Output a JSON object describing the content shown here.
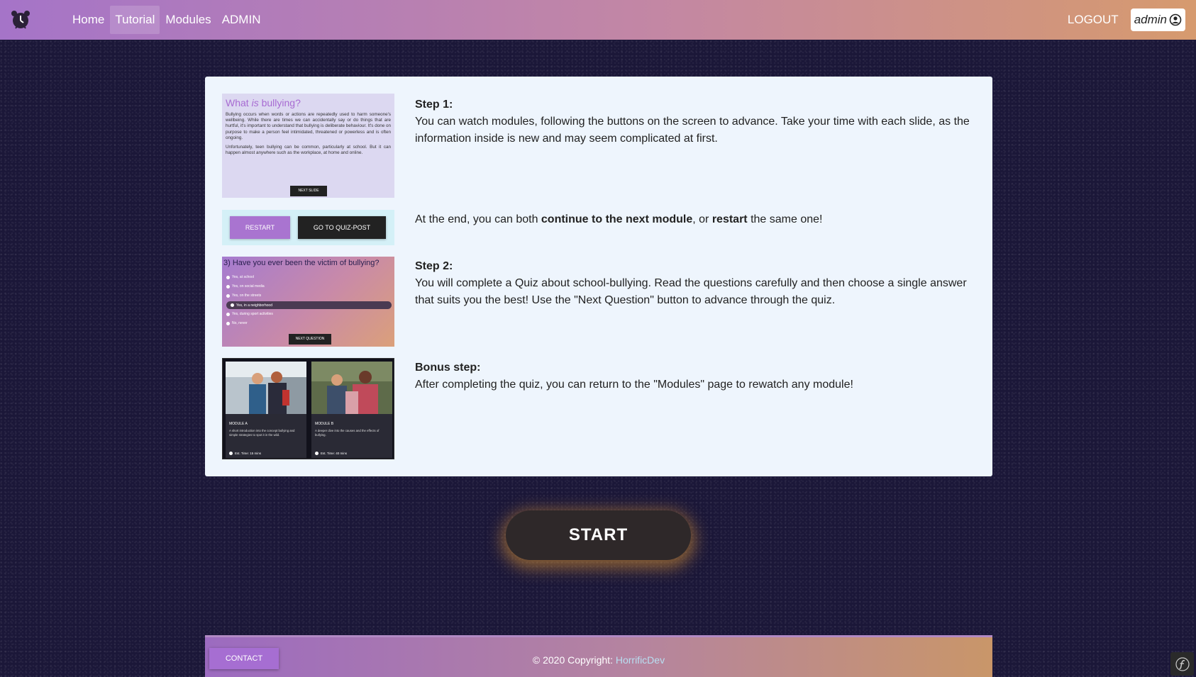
{
  "nav": {
    "items": [
      {
        "label": "Home",
        "active": false
      },
      {
        "label": "Tutorial",
        "active": true
      },
      {
        "label": "Modules",
        "active": false
      },
      {
        "label": "ADMIN",
        "active": false
      }
    ],
    "logout_label": "LOGOUT",
    "user_label": "admin",
    "logo_icon": "alarm-clock-icon",
    "user_icon": "user-circle-icon"
  },
  "thumbnails": {
    "t1": {
      "title_prefix": "What ",
      "title_italic": "is",
      "title_suffix": " bullying?",
      "p1": "Bullying occurs when words or actions are repeatedly used to harm someone's wellbeing. While there are times we can accidentally say or do things that are hurtful, it's important to understand that bullying is deliberate behaviour. It's done on purpose to make a person feel intimidated, threatened or powerless and is often ongoing.",
      "p2": "Unfortunately, teen bullying can be common, particularly at school. But it can happen almost anywhere such as the workplace, at home and online.",
      "button": "NEXT SLIDE"
    },
    "t2": {
      "restart": "RESTART",
      "quiz": "GO TO QUIZ-POST"
    },
    "t3": {
      "question": "3) Have you ever been the victim of bullying?",
      "options": [
        "Yes, at school",
        "Yes, on social media",
        "Yes, on the streets",
        "Yes, in a neighborhood",
        "Yes, during sport activities",
        "No, never"
      ],
      "button": "NEXT QUESTION"
    },
    "t4": {
      "module_a": {
        "title": "MODULE A",
        "desc": "A short introduction into the concept bullying and simple strategies to spot it in the wild.",
        "time": "Est. Time: 15 mins"
      },
      "module_b": {
        "title": "MODULE B",
        "desc": "A deeper dive into the causes and the effects of bullying.",
        "time": "Est. Time: 40 mins"
      }
    }
  },
  "steps": {
    "step1": {
      "heading": "Step 1:",
      "text": "You can watch modules, following the buttons on the screen to advance. Take your time with each slide, as the information inside is new and may seem complicated at first."
    },
    "end": {
      "pre": "At the end, you can both ",
      "b1": "continue to the next module",
      "mid": ", or ",
      "b2": "restart",
      "post": " the same one!"
    },
    "step2": {
      "heading": "Step 2:",
      "text": "You will complete a Quiz about school-bullying. Read the questions carefully and then choose a single answer that suits you the best! Use the \"Next Question\" button to advance through the quiz."
    },
    "bonus": {
      "heading": "Bonus step:",
      "text": "After completing the quiz, you can return to the \"Modules\" page to rewatch any module!"
    }
  },
  "start_label": "START",
  "footer": {
    "contact_label": "CONTACT",
    "copyright_prefix": "© 2020 Copyright: ",
    "brand": "HorrificDev",
    "corner_icon": "symfony-icon"
  },
  "colors": {
    "accent_purple": "#a66ed2",
    "nav_gradient_start": "#a574c8",
    "nav_gradient_end": "#d69a6e",
    "page_bg": "#1b1738",
    "card_bg": "#eef5fd",
    "start_glow": "#dc9632"
  }
}
